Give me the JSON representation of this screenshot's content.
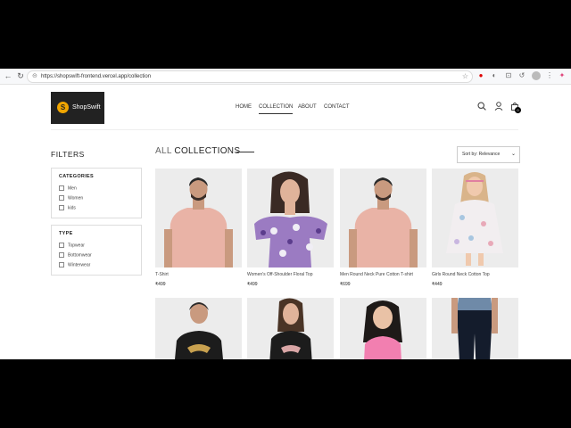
{
  "browser": {
    "url": "https://shopswift-frontend.vercel.app/collection",
    "icons": [
      "back-icon",
      "forward-icon",
      "reload-icon",
      "lock-icon",
      "star-icon",
      "extension-icon"
    ]
  },
  "header": {
    "logo_text": "ShopSwift",
    "logo_letter": "S",
    "nav": [
      "HOME",
      "COLLECTION",
      "ABOUT",
      "CONTACT"
    ],
    "active_nav": "COLLECTION",
    "cart_count": "0"
  },
  "filters": {
    "title": "FILTERS",
    "categories_title": "CATEGORIES",
    "categories": [
      "Men",
      "Women",
      "kids"
    ],
    "type_title": "TYPE",
    "types": [
      "Topwear",
      "Bottomwear",
      "Winterwear"
    ]
  },
  "collection": {
    "title_light": "ALL",
    "title_bold": "COLLECTIONS",
    "sort_label": "Sort by: Relevance",
    "products": [
      {
        "name": "T-Shirt",
        "price": "₹499"
      },
      {
        "name": "Women's Off-Shoulder Floral Top",
        "price": "₹499"
      },
      {
        "name": "Men Round Neck Pure Cotton T-shirt",
        "price": "₹699"
      },
      {
        "name": "Girls Round Neck Cotton Top",
        "price": "₹449"
      }
    ]
  },
  "colors": {
    "accent": "#f0a500",
    "logo_bg": "#222222"
  }
}
